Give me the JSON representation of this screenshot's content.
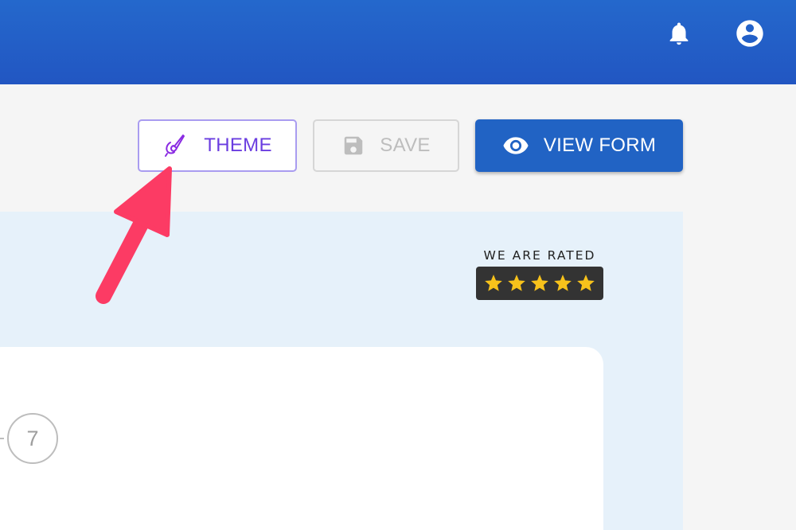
{
  "header": {
    "notifications_icon": "bell-icon",
    "account_icon": "account-circle-icon",
    "background_color": "#2262c8"
  },
  "toolbar": {
    "theme_label": "THEME",
    "theme_icon": "paintbrush-icon",
    "save_label": "SAVE",
    "save_icon": "floppy-disk-icon",
    "view_form_label": "VIEW FORM",
    "view_form_icon": "eye-icon",
    "accent_color": "#2163c4"
  },
  "form_preview": {
    "rating_badge": {
      "label": "WE ARE RATED",
      "stars": 5,
      "star_color": "#f7c21b"
    },
    "step_number": "7"
  },
  "annotation": {
    "arrow_color": "#fc3b64",
    "points_to": "theme-button"
  }
}
